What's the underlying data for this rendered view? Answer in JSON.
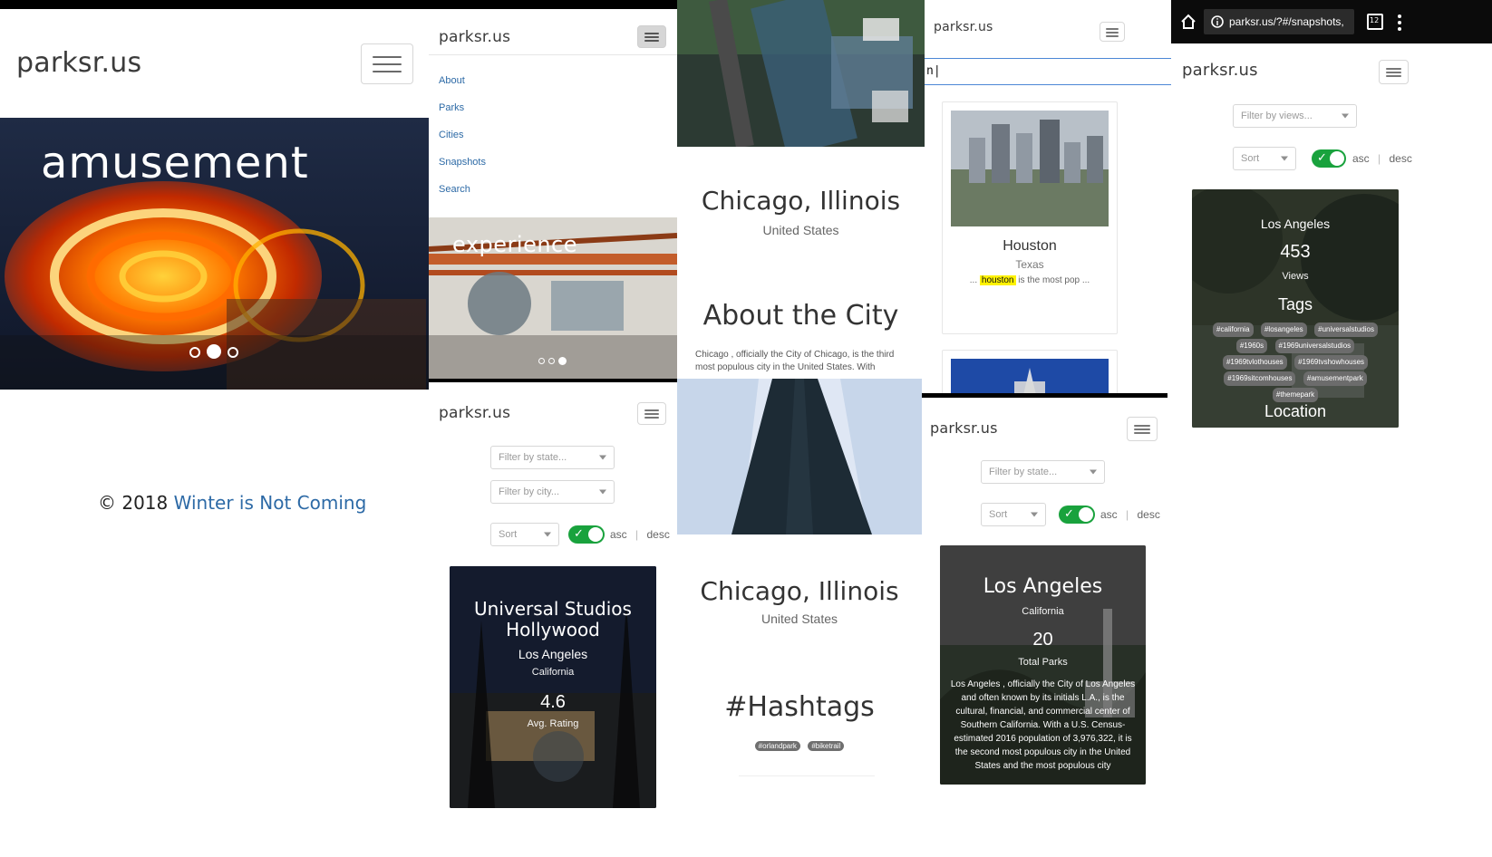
{
  "browser": {
    "url_text": "parksr.us/?#/snapshots,",
    "tab_count": "12"
  },
  "panel1": {
    "brand": "parksr.us",
    "hero_word": "amusement",
    "footer": {
      "copyright": "© 2018",
      "link": "Winter is Not Coming"
    }
  },
  "panel2": {
    "brand": "parksr.us",
    "nav": [
      "About",
      "Parks",
      "Cities",
      "Snapshots",
      "Search"
    ],
    "hero_word": "experience"
  },
  "panel3": {
    "city_title": "Chicago, Illinois",
    "country": "United States",
    "section_title": "About the City",
    "about_text": "Chicago , officially the City of Chicago, is the third most populous city in the United States. With"
  },
  "panel4": {
    "brand": "parksr.us",
    "search_value": "n|",
    "result": {
      "title": "Houston",
      "subtitle": "Texas",
      "snippet_prefix": "... ",
      "highlight": "houston",
      "snippet_suffix": " is the most pop ..."
    }
  },
  "panel5": {
    "brand": "parksr.us",
    "filter_placeholder": "Filter by views...",
    "sort_label": "Sort",
    "asc": "asc",
    "desc": "desc",
    "card": {
      "city": "Los Angeles",
      "views": "453",
      "views_label": "Views",
      "tags_title": "Tags",
      "tags": [
        "#california",
        "#losangeles",
        "#universalstudios",
        "#1960s",
        "#1969universalstudios",
        "#1969tvlothouses",
        "#1969tvshowhouses",
        "#1969sitcomhouses",
        "#amusementpark",
        "#themepark"
      ],
      "bottom_title": "Location"
    }
  },
  "panel6": {
    "brand": "parksr.us",
    "state_placeholder": "Filter by state...",
    "city_placeholder": "Filter by city...",
    "sort_label": "Sort",
    "asc": "asc",
    "desc": "desc",
    "card": {
      "title_line1": "Universal Studios",
      "title_line2": "Hollywood",
      "city": "Los Angeles",
      "state": "California",
      "rating": "4.6",
      "rating_label": "Avg. Rating"
    }
  },
  "panel7": {
    "city_title": "Chicago, Illinois",
    "country": "United States",
    "hashtags_title": "#Hashtags",
    "hashtags": [
      "#orlandpark",
      "#biketrail"
    ]
  },
  "panel8": {
    "brand": "parksr.us",
    "state_placeholder": "Filter by state...",
    "sort_label": "Sort",
    "asc": "asc",
    "desc": "desc",
    "card": {
      "city": "Los Angeles",
      "state": "California",
      "parks_count": "20",
      "parks_label": "Total Parks",
      "description": "Los Angeles , officially the City of Los Angeles and often known by its initials L.A., is the cultural, financial, and commercial center of Southern California. With a U.S. Census-estimated 2016 population of 3,976,322, it is the second most populous city in the United States and the most populous city"
    }
  },
  "colors": {
    "brand_text": "#3b3b3b",
    "link": "#2d6aa6",
    "toggle_green": "#19a23d",
    "highlight_yellow": "#fff200"
  }
}
